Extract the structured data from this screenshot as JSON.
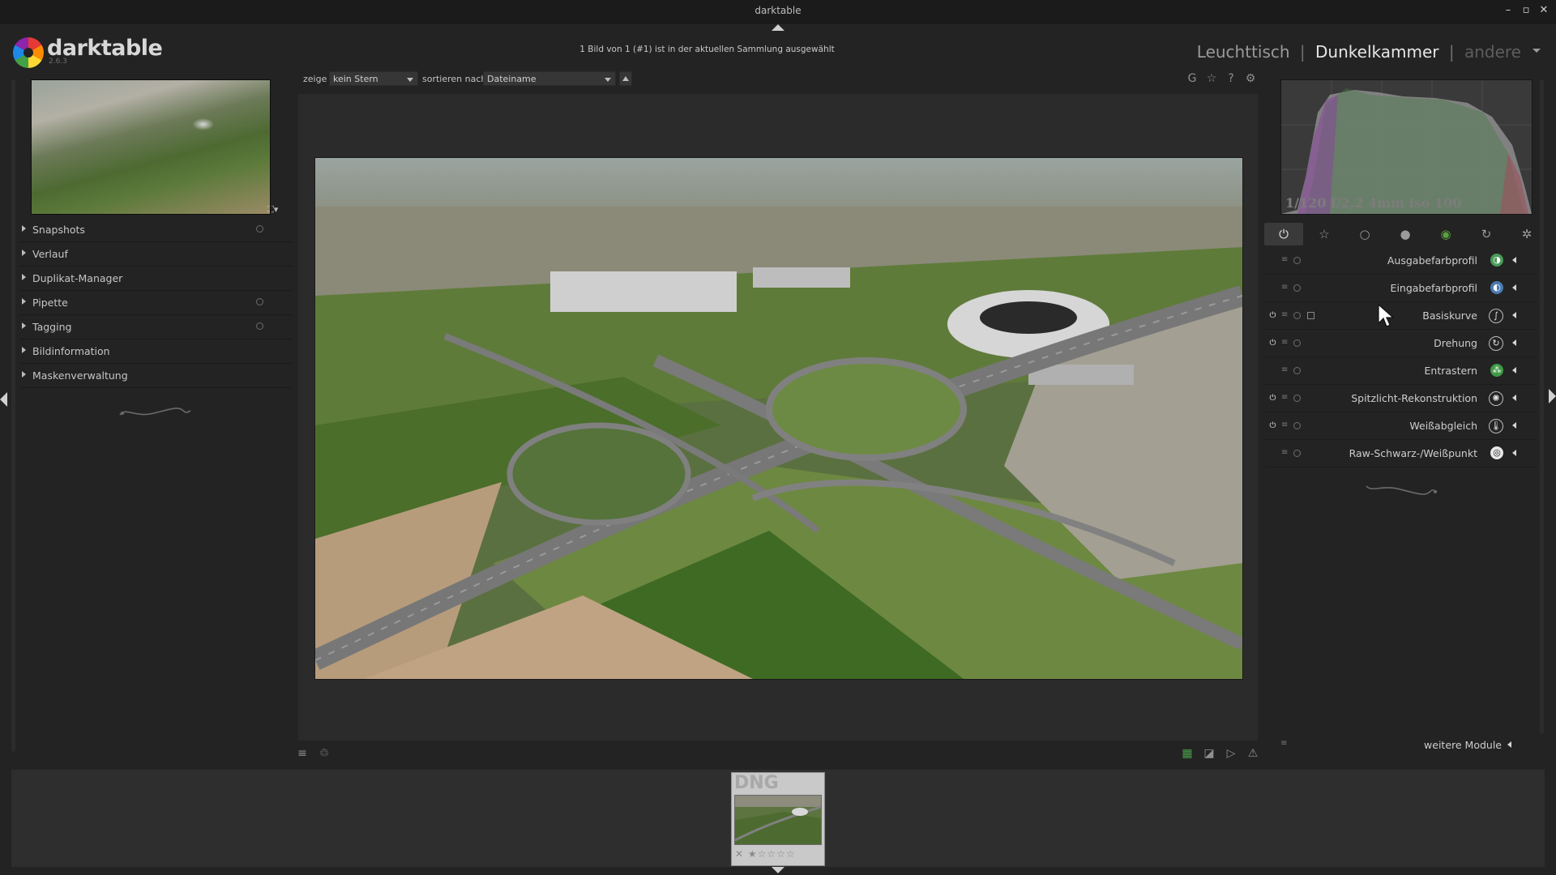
{
  "window": {
    "title": "darktable",
    "minimize_icon": "minimize-icon",
    "maximize_icon": "maximize-icon",
    "close_icon": "close-icon"
  },
  "header": {
    "app_name": "darktable",
    "app_version": "2.6.3",
    "selection_info": "1 Bild von 1 (#1) ist in der aktuellen Sammlung ausgewählt",
    "views": [
      {
        "label": "Leuchttisch",
        "state": "inactive"
      },
      {
        "label": "|",
        "state": "separator"
      },
      {
        "label": "Dunkelkammer",
        "state": "active"
      },
      {
        "label": "|",
        "state": "separator"
      },
      {
        "label": "andere",
        "state": "dim"
      }
    ]
  },
  "left_panel": {
    "modules": [
      {
        "label": "Snapshots",
        "has_preset": true
      },
      {
        "label": "Verlauf",
        "has_preset": false
      },
      {
        "label": "Duplikat-Manager",
        "has_preset": false
      },
      {
        "label": "Pipette",
        "has_preset": true
      },
      {
        "label": "Tagging",
        "has_preset": true
      },
      {
        "label": "Bildinformation",
        "has_preset": false
      },
      {
        "label": "Maskenverwaltung",
        "has_preset": false
      }
    ]
  },
  "toolbar": {
    "show_label": "zeige",
    "show_value": "kein Stern",
    "sort_label": "sortieren nach",
    "sort_value": "Dateiname",
    "sort_direction_icon": "sort-ascending-icon",
    "right_icons": [
      "grouping-icon",
      "star-overlay-icon",
      "help-icon",
      "preferences-gear-icon"
    ],
    "right_glyphs": [
      "G",
      "☆",
      "?",
      "⚙"
    ]
  },
  "bottom_toolbar": {
    "left_icons": [
      "presets-menu-icon",
      "styles-icon"
    ],
    "left_glyphs": [
      "≡",
      "♲"
    ],
    "right_icons": [
      "color-assessment-icon",
      "overexposed-indicator-icon",
      "softproof-icon",
      "gamut-check-icon"
    ],
    "right_glyphs": [
      "▦",
      "◪",
      "▷",
      "⚠"
    ]
  },
  "right_panel": {
    "histogram_info": "1/120 f/2,2 4mm iso 100",
    "group_icons": [
      "active-modules-power-icon",
      "favorites-star-icon",
      "basic-group-icon",
      "tone-group-icon",
      "color-group-icon",
      "correct-group-icon",
      "effect-group-icon"
    ],
    "group_glyphs": [
      "⏻",
      "☆",
      "○",
      "●",
      "◉",
      "↻",
      "✲"
    ],
    "modules": [
      {
        "label": "Ausgabefarbprofil",
        "power": false,
        "icon": "output-color-profile-icon",
        "icon_glyph": "◑",
        "icon_color": "#4a9a5a"
      },
      {
        "label": "Eingabefarbprofil",
        "power": false,
        "icon": "input-color-profile-icon",
        "icon_glyph": "◐",
        "icon_color": "#4a7ab0"
      },
      {
        "label": "Basiskurve",
        "power": true,
        "icon": "base-curve-icon",
        "icon_glyph": "∫",
        "icon_color": "#3a3a3a"
      },
      {
        "label": "Drehung",
        "power": true,
        "icon": "rotation-icon",
        "icon_glyph": "↻",
        "icon_color": "#3a3a3a"
      },
      {
        "label": "Entrastern",
        "power": false,
        "icon": "demosaic-icon",
        "icon_glyph": "⁂",
        "icon_color": "#3f9a45"
      },
      {
        "label": "Spitzlicht-Rekonstruktion",
        "power": true,
        "icon": "highlight-reconstruction-icon",
        "icon_glyph": "✺",
        "icon_color": "#3a3a3a"
      },
      {
        "label": "Weißabgleich",
        "power": true,
        "icon": "white-balance-icon",
        "icon_glyph": "🌡",
        "icon_color": "#3a3a3a"
      },
      {
        "label": "Raw-Schwarz-/Weißpunkt",
        "power": false,
        "icon": "raw-black-white-point-icon",
        "icon_glyph": "◎",
        "icon_color": "#e8e8e8"
      }
    ],
    "more_modules": "weitere Module"
  },
  "filmstrip": {
    "thumbnail_ext": "DNG",
    "rating_text": "✕ ★☆☆☆☆"
  }
}
